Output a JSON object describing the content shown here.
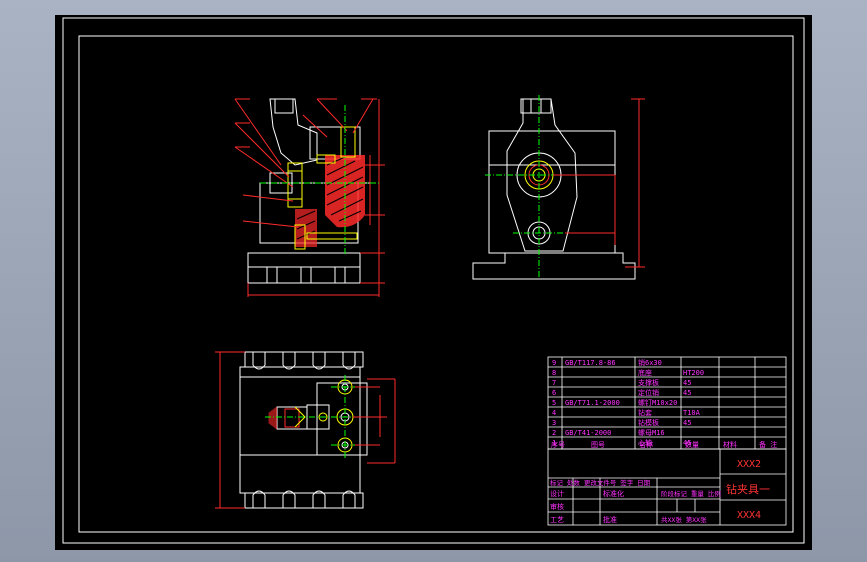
{
  "colors": {
    "background": "#000000",
    "frame": "#ffffff",
    "part": "#ffffff",
    "dimension": "#ff0000",
    "centerline": "#00ff00",
    "hatch": "#ff0000",
    "fastener": "#ffff00",
    "titleblock_text": "#ff00ff",
    "titleblock_lines": "#ffffff"
  },
  "parts_list": [
    {
      "no": "9",
      "code": "GB/T117.8-86",
      "name": "销6x30",
      "qty": "",
      "material": "",
      "remark": ""
    },
    {
      "no": "8",
      "code": "",
      "name": "底座",
      "qty": "",
      "material": "HT200",
      "remark": ""
    },
    {
      "no": "7",
      "code": "",
      "name": "支撑板",
      "qty": "",
      "material": "45",
      "remark": ""
    },
    {
      "no": "6",
      "code": "",
      "name": "定位销",
      "qty": "",
      "material": "45",
      "remark": ""
    },
    {
      "no": "5",
      "code": "GB/T71.1-2000",
      "name": "螺钉M10x20",
      "qty": "",
      "material": "",
      "remark": ""
    },
    {
      "no": "4",
      "code": "",
      "name": "钻套",
      "qty": "",
      "material": "T10A",
      "remark": ""
    },
    {
      "no": "3",
      "code": "",
      "name": "钻模板",
      "qty": "",
      "material": "45",
      "remark": ""
    },
    {
      "no": "2",
      "code": "GB/T41-2000",
      "name": "螺母M16",
      "qty": "",
      "material": "",
      "remark": ""
    },
    {
      "no": "1",
      "code": "",
      "name": "心轴",
      "qty": "",
      "material": "45",
      "remark": ""
    }
  ],
  "parts_header": {
    "no": "序号",
    "code": "图号",
    "name": "名称",
    "qty": "数量",
    "material": "材料",
    "remark": "备 注"
  },
  "title_block": {
    "drawing_no_top": "XXX2",
    "title": "钻夹具一",
    "drawing_no_bottom": "XXX4",
    "revision_row": "标记 处数 更改文件号 签字 日期",
    "design": "设计",
    "standard": "标准化",
    "review": "审核",
    "process": "工艺",
    "approve": "批准",
    "stage": "阶段标记 重量 比例",
    "sheets": "共XX张 第XX张"
  }
}
